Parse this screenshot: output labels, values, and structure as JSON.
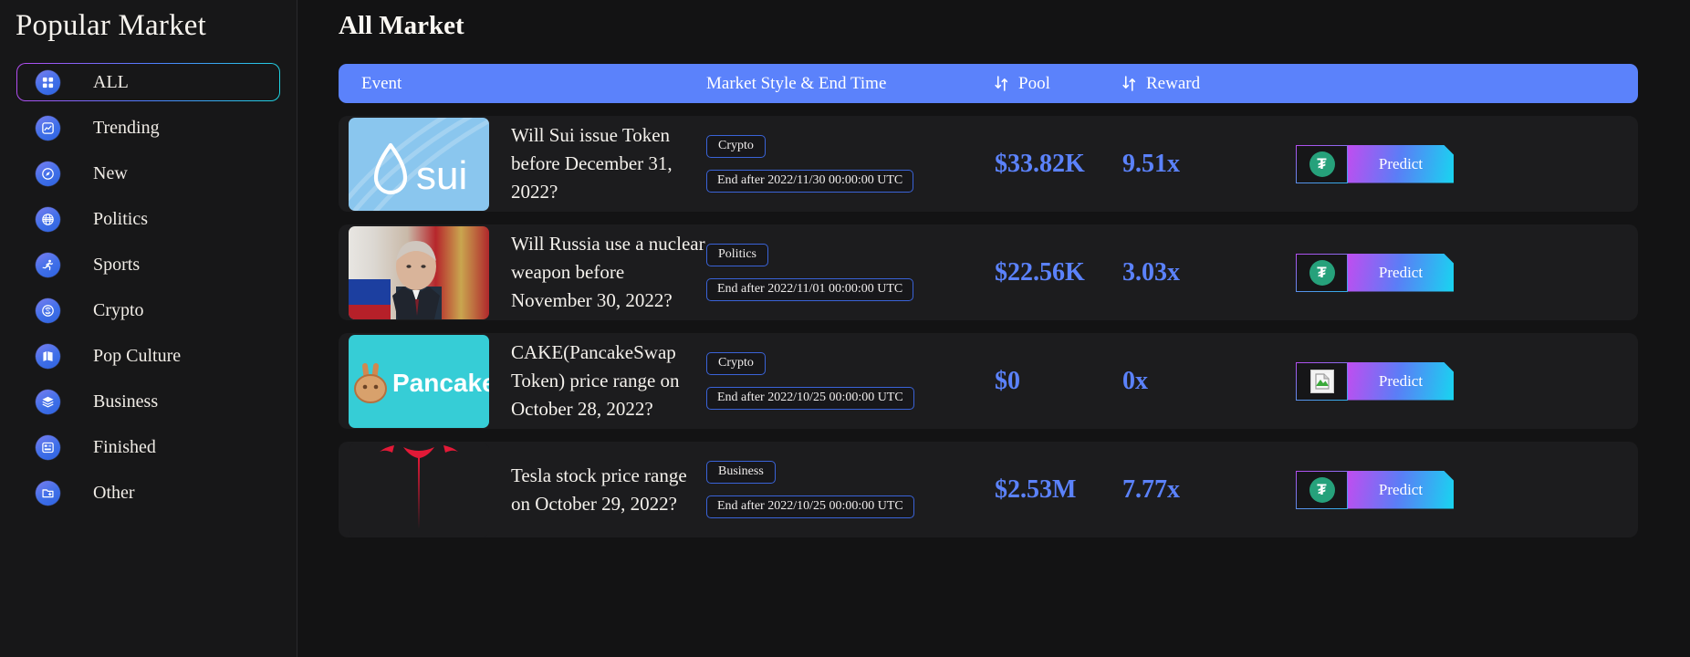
{
  "sidebar": {
    "title": "Popular Market",
    "items": [
      {
        "label": "ALL",
        "icon": "grid-icon",
        "active": true
      },
      {
        "label": "Trending",
        "icon": "chart-line-icon",
        "active": false
      },
      {
        "label": "New",
        "icon": "compass-icon",
        "active": false
      },
      {
        "label": "Politics",
        "icon": "globe-icon",
        "active": false
      },
      {
        "label": "Sports",
        "icon": "runner-icon",
        "active": false
      },
      {
        "label": "Crypto",
        "icon": "coin-swap-icon",
        "active": false
      },
      {
        "label": "Pop Culture",
        "icon": "map-icon",
        "active": false
      },
      {
        "label": "Business",
        "icon": "layers-icon",
        "active": false
      },
      {
        "label": "Finished",
        "icon": "layout-icon",
        "active": false
      },
      {
        "label": "Other",
        "icon": "folder-icon",
        "active": false
      }
    ]
  },
  "main": {
    "title": "All Market",
    "table": {
      "headers": {
        "event": "Event",
        "style": "Market Style & End Time",
        "pool": "Pool",
        "reward": "Reward"
      },
      "rows": [
        {
          "title": "Will Sui issue Token before December 31, 2022?",
          "thumb": "sui-logo",
          "category": "Crypto",
          "end_time": "End after 2022/11/30 00:00:00 UTC",
          "pool": "$33.82K",
          "reward": "9.51x",
          "token_icon": "usdt-icon",
          "action_label": "Predict"
        },
        {
          "title": "Will Russia use a nuclear weapon before November 30, 2022?",
          "thumb": "putin-photo",
          "category": "Politics",
          "end_time": "End after 2022/11/01 00:00:00 UTC",
          "pool": "$22.56K",
          "reward": "3.03x",
          "token_icon": "usdt-icon",
          "action_label": "Predict"
        },
        {
          "title": "CAKE(PancakeSwap Token) price range on October 28, 2022?",
          "thumb": "pancakeswap-logo",
          "category": "Crypto",
          "end_time": "End after 2022/10/25 00:00:00 UTC",
          "pool": "$0",
          "reward": "0x",
          "token_icon": "broken-image-icon",
          "action_label": "Predict"
        },
        {
          "title": "Tesla stock price range on October 29, 2022?",
          "thumb": "tesla-logo",
          "category": "Business",
          "end_time": "End after 2022/10/25 00:00:00 UTC",
          "pool": "$2.53M",
          "reward": "7.77x",
          "token_icon": "usdt-icon",
          "action_label": "Predict"
        }
      ]
    }
  },
  "colors": {
    "accent_blue": "#5b82fb",
    "header_bar": "#5b82fb",
    "page_bg": "#131314",
    "sidebar_bg": "#171718",
    "row_bg": "#1c1c1e",
    "gradient_start": "#c04df0",
    "gradient_end": "#18d5f0",
    "usdt_green": "#26a17b"
  }
}
